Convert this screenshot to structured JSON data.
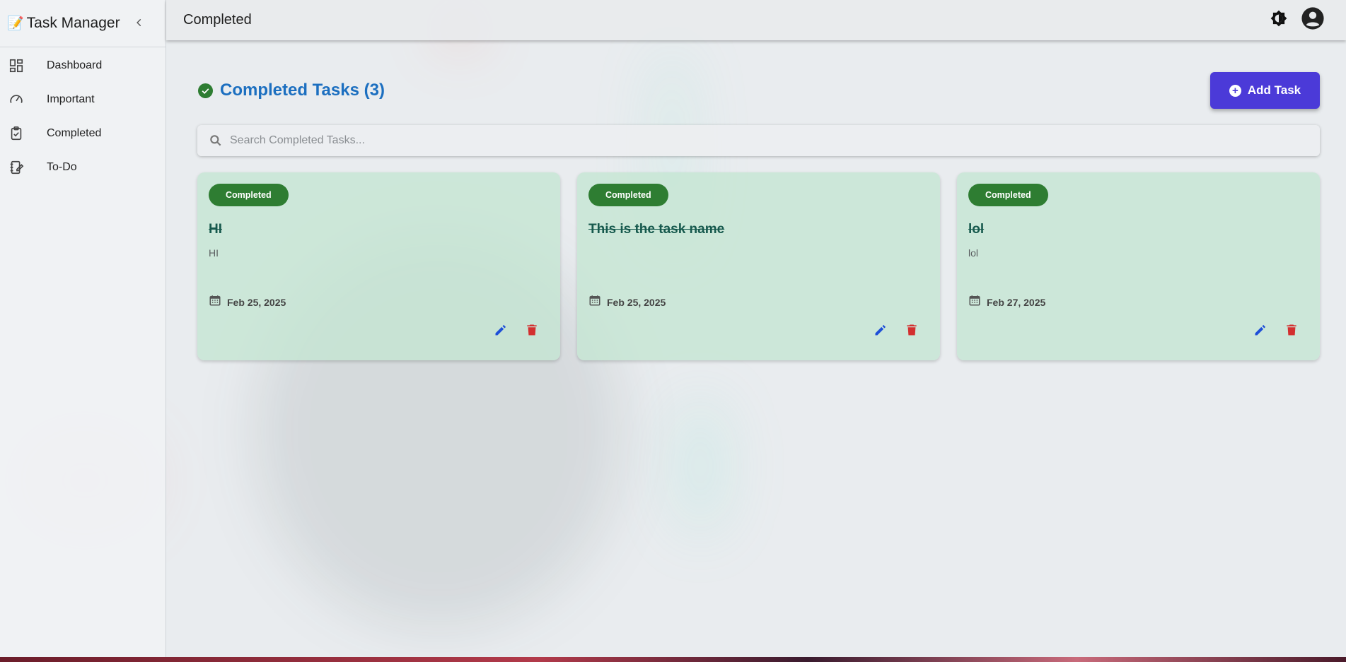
{
  "sidebar": {
    "brand_emoji": "📝",
    "brand_title": "Task Manager",
    "collapse_icon": "chevron-left-icon",
    "items": [
      {
        "label": "Dashboard",
        "icon": "dashboard-icon"
      },
      {
        "label": "Important",
        "icon": "speedometer-icon"
      },
      {
        "label": "Completed",
        "icon": "clipboard-check-icon"
      },
      {
        "label": "To-Do",
        "icon": "notebook-edit-icon"
      }
    ]
  },
  "header": {
    "title": "Completed",
    "theme_icon": "brightness-icon",
    "account_icon": "account-circle-icon"
  },
  "main": {
    "heading": "Completed Tasks (3)",
    "add_button_label": "Add Task",
    "search_placeholder": "Search Completed Tasks..."
  },
  "tasks": [
    {
      "status": "Completed",
      "title": "HI",
      "description": "HI",
      "date": "Feb 25, 2025"
    },
    {
      "status": "Completed",
      "title": "This is the task name",
      "description": "",
      "date": "Feb 25, 2025"
    },
    {
      "status": "Completed",
      "title": "lol",
      "description": "lol",
      "date": "Feb 27, 2025"
    }
  ],
  "colors": {
    "accent": "#4b3ad8",
    "heading": "#1c6fc0",
    "status_badge": "#2e7d32",
    "edit_icon": "#1e4fd8",
    "delete_icon": "#d32f2f",
    "card_bg": "#c4e6d2"
  }
}
